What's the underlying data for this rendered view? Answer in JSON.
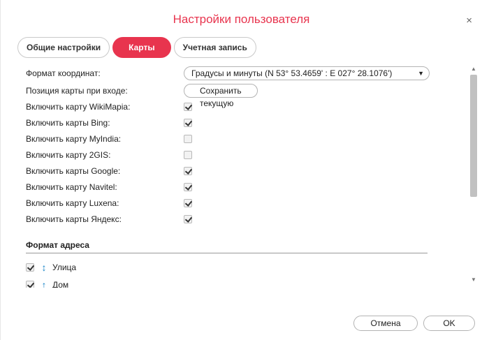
{
  "dialog": {
    "title": "Настройки пользователя",
    "close_glyph": "×",
    "accent_color": "#e8344e"
  },
  "tabs": [
    {
      "label": "Общие настройки",
      "active": false
    },
    {
      "label": "Карты",
      "active": true
    },
    {
      "label": "Учетная запись",
      "active": false
    }
  ],
  "settings": {
    "coord_format": {
      "label": "Формат координат:",
      "value": "Градусы и минуты (N 53° 53.4659' : E 027° 28.1076')",
      "arrow": "▼"
    },
    "map_position": {
      "label": "Позиция карты при входе:",
      "button": "Сохранить текущую"
    },
    "map_toggles": [
      {
        "label": "Включить карту WikiMapia:",
        "checked": true
      },
      {
        "label": "Включить карты Bing:",
        "checked": true
      },
      {
        "label": "Включить карту MyIndia:",
        "checked": false
      },
      {
        "label": "Включить карту 2GIS:",
        "checked": false
      },
      {
        "label": "Включить карты Google:",
        "checked": true
      },
      {
        "label": "Включить карту Navitel:",
        "checked": true
      },
      {
        "label": "Включить карту Luxena:",
        "checked": true
      },
      {
        "label": "Включить карты Яндекс:",
        "checked": true
      }
    ]
  },
  "address_format": {
    "heading": "Формат адреса",
    "items": [
      {
        "label": "Улица",
        "checked": true,
        "icon": "↕",
        "icon_name": "sort-updown-icon"
      },
      {
        "label": "Дом",
        "checked": true,
        "icon": "↑",
        "icon_name": "move-up-icon"
      }
    ]
  },
  "scrollbar": {
    "up": "▲",
    "down": "▼"
  },
  "footer": {
    "cancel_label": "Отмена",
    "ok_label": "OK"
  }
}
